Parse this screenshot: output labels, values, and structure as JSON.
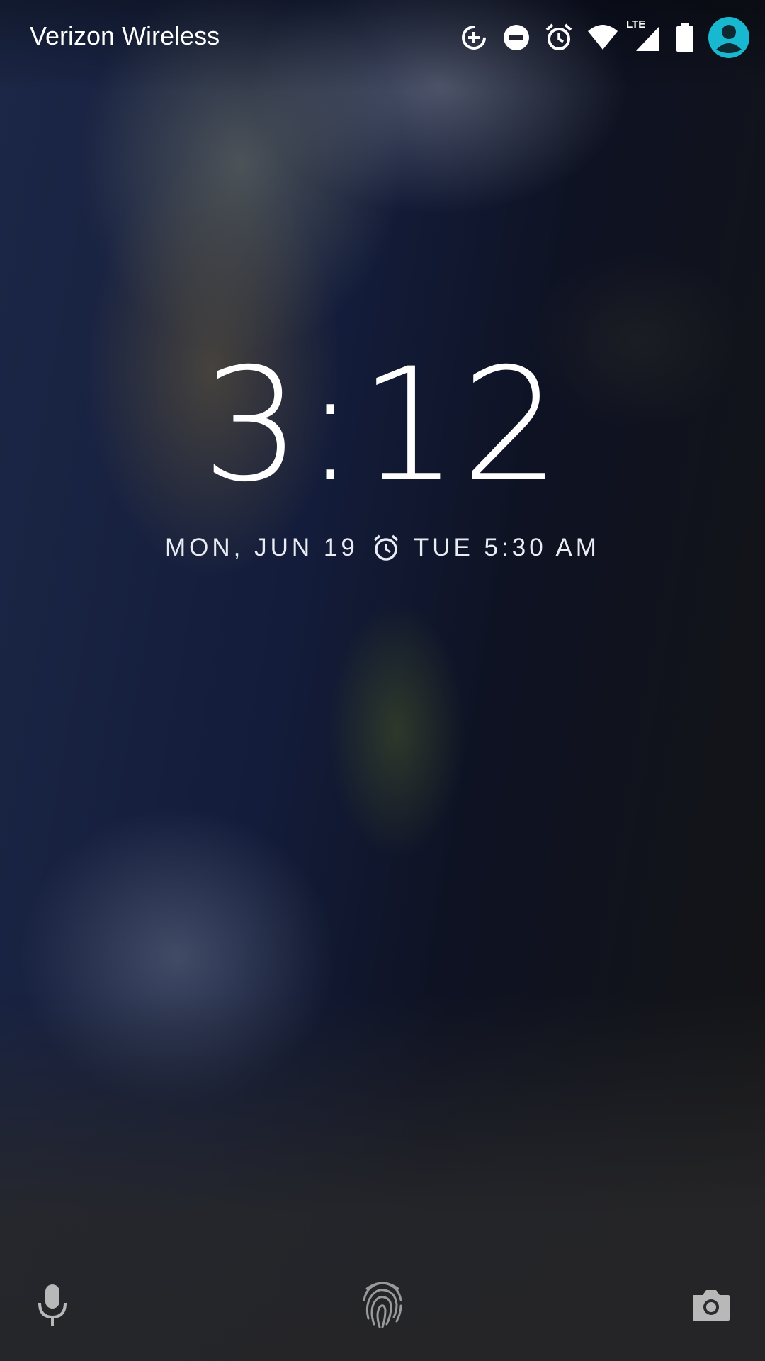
{
  "status_bar": {
    "carrier": "Verizon Wireless",
    "icons": [
      "data-saver-icon",
      "do-not-disturb-icon",
      "alarm-icon",
      "wifi-icon",
      "lte-signal-icon",
      "battery-icon",
      "user-avatar-icon"
    ],
    "network_label": "LTE"
  },
  "lockscreen": {
    "time": "3:12",
    "date": "MON, JUN 19",
    "next_alarm": "TUE 5:30 AM"
  },
  "bottom_bar": {
    "left_icon": "mic-icon",
    "center_icon": "fingerprint-icon",
    "right_icon": "camera-icon"
  },
  "colors": {
    "accent_avatar": "#18b8d0",
    "text": "#ffffff",
    "bottom_icons": "#b8b8b8"
  }
}
